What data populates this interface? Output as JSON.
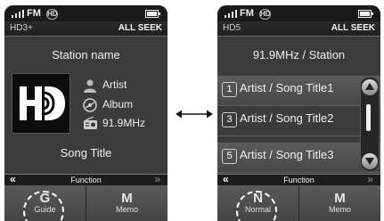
{
  "left_screen": {
    "status": {
      "band": "FM",
      "hd_symbol": "HD"
    },
    "sub_header": {
      "channel": "HD3+",
      "seek_mode": "ALL SEEK"
    },
    "station_name": "Station name",
    "meta": {
      "artist": "Artist",
      "album": "Album",
      "frequency": "91.9MHz"
    },
    "song_title": "Song Title",
    "function_bar": {
      "back": "«",
      "label": "Function",
      "next": "»"
    },
    "softkeys": {
      "left": {
        "letter": "G",
        "label": "Guide",
        "highlighted": true
      },
      "right": {
        "letter": "M",
        "label": "Memo"
      }
    },
    "icons": [
      "signal-icon",
      "hd-icon",
      "battery-icon",
      "hd-radio-logo",
      "person-icon",
      "disc-icon",
      "radio-icon"
    ]
  },
  "right_screen": {
    "status": {
      "band": "FM",
      "hd_symbol": "HD"
    },
    "sub_header": {
      "channel": "HD5",
      "seek_mode": "ALL SEEK"
    },
    "title": "91.9MHz / Station",
    "list": [
      {
        "number": "1",
        "text": "Artist / Song Title1",
        "highlighted": true
      },
      {
        "number": "3",
        "text": "Artist / Song Title2",
        "highlighted": false
      },
      {
        "number": "5",
        "text": "Artist / Song Title3",
        "highlighted": true
      }
    ],
    "function_bar": {
      "back": "«",
      "label": "Function",
      "next": "»"
    },
    "softkeys": {
      "left": {
        "letter": "N",
        "label": "Normal",
        "highlighted": true
      },
      "right": {
        "letter": "M",
        "label": "Memo"
      }
    },
    "icons": [
      "signal-icon",
      "hd-icon",
      "battery-icon",
      "scroll-up-icon",
      "scroll-down-icon"
    ]
  },
  "connector": "double-headed-arrow-icon",
  "colors": {
    "screen_bg": "#3b3b3b",
    "bar_bg": "#1a1a1a",
    "text": "#f0f0f0",
    "ring": "#ffffff"
  }
}
